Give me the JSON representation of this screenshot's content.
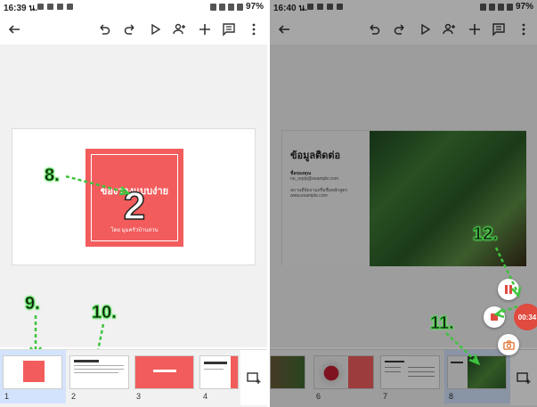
{
  "left": {
    "status": {
      "time": "16:39 น.",
      "battery": "97%"
    },
    "slide": {
      "title": "ของว่างแบบง่าย",
      "big_number": "2",
      "subtitle": "โดย มุมครัวบ้านสวน"
    },
    "thumbnails": [
      {
        "num": "1"
      },
      {
        "num": "2"
      },
      {
        "num": "3"
      },
      {
        "num": "4"
      }
    ],
    "annotations": {
      "a8": "8.",
      "a9": "9.",
      "a10": "10."
    }
  },
  "right": {
    "status": {
      "time": "16:40 น.",
      "battery": "97%"
    },
    "slide": {
      "heading": "ข้อมูลติดต่อ",
      "name": "ชื่อของคุณ",
      "email": "no_reply@example.com",
      "line1": "สถานที่จัดงานหรือชื่อหลักสูตร",
      "line2": "www.example.com"
    },
    "recorder": {
      "timer": "00:34"
    },
    "thumbnails": [
      {
        "num": "6"
      },
      {
        "num": "7"
      },
      {
        "num": "8"
      }
    ],
    "annotations": {
      "a11": "11.",
      "a12": "12."
    }
  },
  "colors": {
    "accent_red": "#f25c5c",
    "annotation_green": "#3ec43e",
    "selection_blue": "#d3e3fd"
  }
}
